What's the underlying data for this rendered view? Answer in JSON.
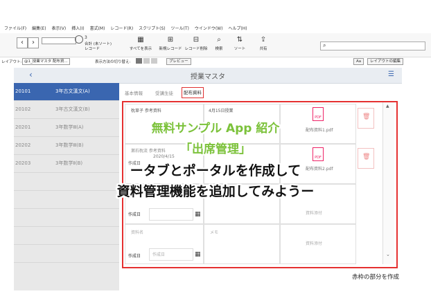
{
  "menubar": [
    "ファイル(F)",
    "編集(E)",
    "表示(V)",
    "挿入(I)",
    "書式(M)",
    "レコード(R)",
    "スクリプト(S)",
    "ツール(T)",
    "ウインドウ(W)",
    "ヘルプ(H)"
  ],
  "toolbar": {
    "record_count": "3",
    "record_label": "合計 (未ソート)",
    "record_label2": "レコード",
    "show_all": "すべてを表示",
    "new_record": "新規レコード",
    "delete_record": "レコード削除",
    "search": "検索",
    "sort": "ソート",
    "share": "共有"
  },
  "layoutbar": {
    "layout_label": "レイアウト:",
    "layout_value": "@1_授業マスタ 配布資...",
    "view_label": "表示方法の切り替え:",
    "preview": "プレビュー",
    "aa": "Aa",
    "edit_layout": "レイアウトの編集"
  },
  "header": {
    "title": "授業マスタ"
  },
  "list": [
    {
      "code": "20101",
      "name": "3年古文漢文(A)"
    },
    {
      "code": "20102",
      "name": "3年古文漢文(B)"
    },
    {
      "code": "20201",
      "name": "3年数学Ⅲ(A)"
    },
    {
      "code": "20202",
      "name": "3年数学Ⅲ(B)"
    },
    {
      "code": "20203",
      "name": "3年数学Ⅱ(B)"
    }
  ],
  "tabs": [
    "基本情報",
    "受講生徒",
    "配布資料"
  ],
  "portal": {
    "rows": [
      {
        "name": "枕草子 参考資料",
        "date_label": "作成日",
        "date": "",
        "memo": "4月15日授業",
        "file": "配布資料1.pdf"
      },
      {
        "name": "漱石枕流 参考資料",
        "date_label": "作成日",
        "date": "2020/4/15",
        "memo": "",
        "file": "配布資料2.pdf"
      },
      {
        "name": "",
        "date_label": "作成日",
        "date": "",
        "memo": "",
        "file": "資料添付"
      },
      {
        "name": "資料名",
        "date_label": "作成日",
        "date": "作成日",
        "memo": "メモ",
        "file": "資料添付"
      }
    ]
  },
  "overlay": {
    "line1": "無料サンプル App 紹介",
    "line2": "「出席管理」",
    "line3": "ータブとポータルを作成して",
    "line4": "資料管理機能を追加してみようー"
  },
  "caption": "赤枠の部分を作成",
  "colors": {
    "accent_red": "#e53030",
    "green": "#7cc23b",
    "selected": "#3a66b0"
  }
}
